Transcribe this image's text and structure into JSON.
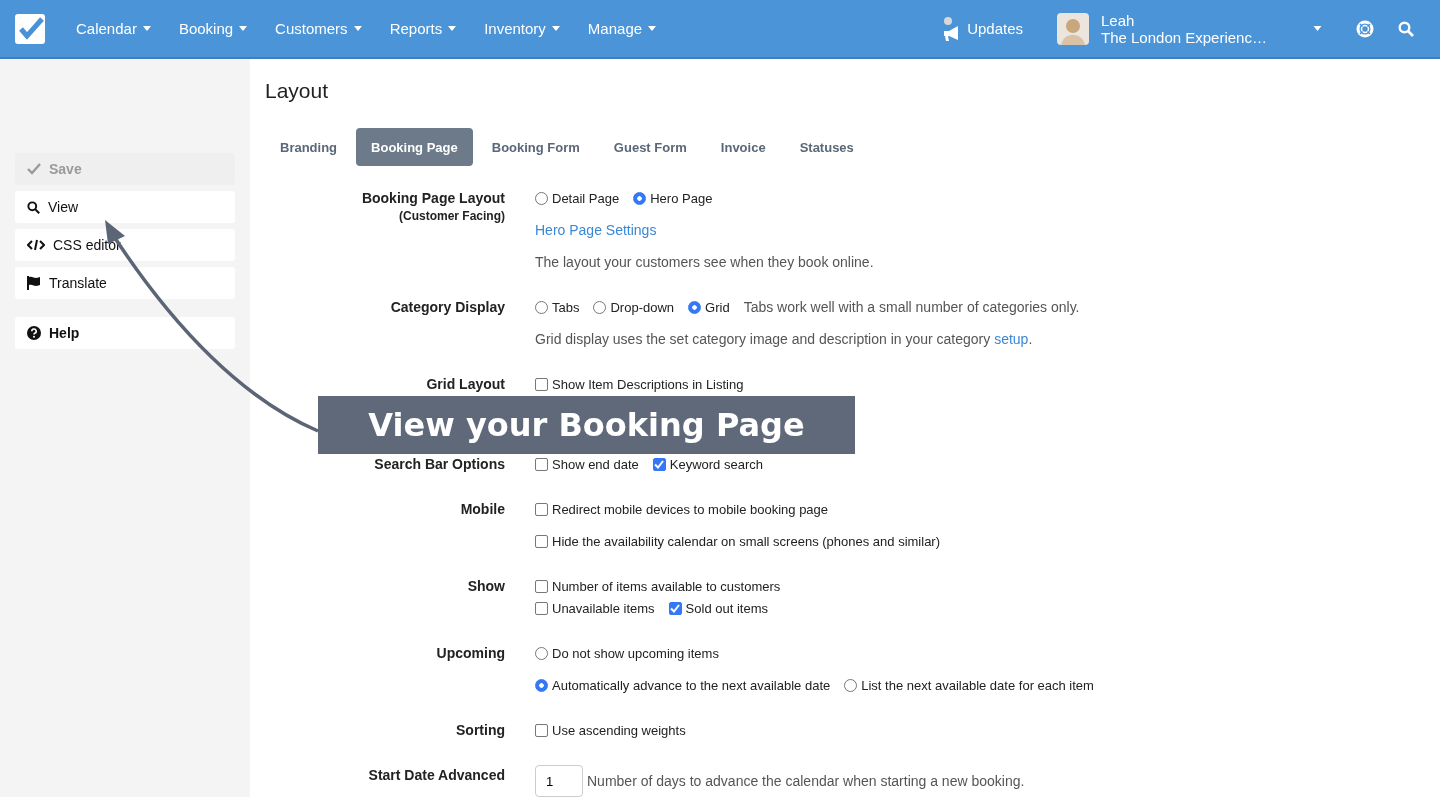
{
  "nav": {
    "menus": [
      {
        "label": "Calendar"
      },
      {
        "label": "Booking"
      },
      {
        "label": "Customers"
      },
      {
        "label": "Reports"
      },
      {
        "label": "Inventory"
      },
      {
        "label": "Manage"
      }
    ],
    "updates": {
      "label": "Updates"
    },
    "user": {
      "name": "Leah",
      "org": "The London Experienc…"
    }
  },
  "sidebar": [
    {
      "kind": "save",
      "label": "Save",
      "disabled": true
    },
    {
      "kind": "view",
      "label": "View",
      "disabled": false
    },
    {
      "kind": "css",
      "label": "CSS editor",
      "disabled": false
    },
    {
      "kind": "translate",
      "label": "Translate",
      "disabled": false
    },
    {
      "kind": "help",
      "label": "Help",
      "disabled": false
    }
  ],
  "page_title": "Layout",
  "tabs": [
    {
      "label": "Branding",
      "selected": false
    },
    {
      "label": "Booking Page",
      "selected": true
    },
    {
      "label": "Booking Form",
      "selected": false
    },
    {
      "label": "Guest Form",
      "selected": false
    },
    {
      "label": "Invoice",
      "selected": false
    },
    {
      "label": "Statuses",
      "selected": false
    }
  ],
  "form": [
    {
      "kind": "field",
      "label": "Booking Page Layout",
      "sublabel": "(Customer Facing)",
      "lines": [
        [
          {
            "kind": "radio",
            "label": "Detail Page",
            "selected": false
          },
          {
            "kind": "radio",
            "label": "Hero Page",
            "selected": true
          }
        ],
        [
          {
            "kind": "link",
            "label": "Hero Page Settings"
          }
        ],
        [
          {
            "kind": "note",
            "label": "The layout your customers see when they book online."
          }
        ]
      ]
    },
    {
      "kind": "field",
      "label": "Category Display",
      "lines": [
        [
          {
            "kind": "radio",
            "label": "Tabs",
            "selected": false
          },
          {
            "kind": "radio",
            "label": "Drop-down",
            "selected": false
          },
          {
            "kind": "radio",
            "label": "Grid",
            "selected": true
          },
          {
            "kind": "note",
            "label": "Tabs work well with a small number of categories only."
          }
        ],
        [
          {
            "kind": "note",
            "label": "Grid display uses the set category image and description in your category ",
            "link": "setup",
            "after": "."
          }
        ]
      ]
    },
    {
      "kind": "field",
      "label": "Grid Layout",
      "lines": [
        [
          {
            "kind": "checkbox",
            "label": "Show Item Descriptions in Listing",
            "checked": false
          }
        ]
      ]
    },
    {
      "kind": "callout",
      "caption": "View your Booking Page"
    },
    {
      "kind": "field",
      "label": "Search Bar Options",
      "lines": [
        [
          {
            "kind": "checkbox",
            "label": "Show end date",
            "checked": false
          },
          {
            "kind": "checkbox",
            "label": "Keyword search",
            "checked": true
          }
        ]
      ]
    },
    {
      "kind": "field",
      "label": "Mobile",
      "lines": [
        [
          {
            "kind": "checkbox",
            "label": "Redirect mobile devices to mobile booking page",
            "checked": false
          }
        ],
        [
          {
            "kind": "checkbox",
            "label": "Hide the availability calendar on small screens (phones and similar)",
            "checked": false
          }
        ]
      ]
    },
    {
      "kind": "field",
      "label": "Show",
      "tight": true,
      "lines": [
        [
          {
            "kind": "checkbox",
            "label": "Number of items available to customers",
            "checked": false
          }
        ],
        [
          {
            "kind": "checkbox",
            "label": "Unavailable items",
            "checked": false
          },
          {
            "kind": "checkbox",
            "label": "Sold out items",
            "checked": true
          }
        ]
      ]
    },
    {
      "kind": "field",
      "label": "Upcoming",
      "lines": [
        [
          {
            "kind": "radio",
            "label": "Do not show upcoming items",
            "selected": false
          }
        ],
        [
          {
            "kind": "radio",
            "label": "Automatically advance to the next available date",
            "selected": true
          },
          {
            "kind": "radio",
            "label": "List the next available date for each item",
            "selected": false
          }
        ]
      ]
    },
    {
      "kind": "field",
      "label": "Sorting",
      "lines": [
        [
          {
            "kind": "checkbox",
            "label": "Use ascending weights",
            "checked": false
          }
        ]
      ]
    },
    {
      "kind": "field",
      "label": "Start Date Advanced",
      "lines": [
        [
          {
            "kind": "input",
            "value": "1"
          },
          {
            "kind": "note",
            "label": "Number of days to advance the calendar when starting a new booking."
          }
        ]
      ]
    }
  ]
}
